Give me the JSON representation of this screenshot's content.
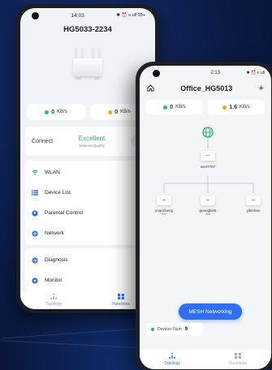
{
  "colors": {
    "accent_blue": "#2f6ff0",
    "status_green": "#2eb872",
    "download_green": "#27c07a",
    "upload_orange": "#f5a623"
  },
  "phone1": {
    "status": {
      "time": "14:03",
      "icons": "✱ ⏰ ≡ ull 35+"
    },
    "title": "HG5033-2234",
    "speeds": [
      {
        "icon": "download-dot",
        "value": "0",
        "unit": "KB/s"
      },
      {
        "icon": "upload-dot",
        "value": "0",
        "unit": "KB/s"
      }
    ],
    "connect": {
      "label": "Connect",
      "quality": "Excellent",
      "quality_label": "Network Quality"
    },
    "menu": [
      {
        "icon": "wifi-icon",
        "label": "WLAN"
      },
      {
        "icon": "list-icon",
        "label": "Device List"
      },
      {
        "icon": "parental-icon",
        "label": "Parental Control"
      },
      {
        "icon": "network-icon",
        "label": "Network"
      }
    ],
    "menu2": [
      {
        "icon": "diagnosis-icon",
        "label": "Diagnosis"
      },
      {
        "icon": "monitor-icon",
        "label": "Monitor"
      }
    ],
    "tabs": [
      {
        "icon": "topology-icon",
        "label": "Topology"
      },
      {
        "icon": "functions-icon",
        "label": "Functions"
      }
    ]
  },
  "phone2": {
    "status": {
      "time": "2:13",
      "icons": "✱ ⏰ ≡ ull"
    },
    "title": "Office_HG5013",
    "speeds": [
      {
        "icon": "download-dot",
        "value": "0",
        "unit": "KB/s"
      },
      {
        "icon": "upload-dot",
        "value": "1.6",
        "unit": "KB/s"
      }
    ],
    "topology": {
      "main_node": "wen7787",
      "children": [
        {
          "name": "yuanzheng",
          "sub": "985"
        },
        {
          "name": "guangbin9",
          "sub": "986"
        },
        {
          "name": "yibinhao",
          "sub": ""
        }
      ]
    },
    "mesh_button": "MESH Networking",
    "devices": {
      "label": "Devices Num",
      "count": "9"
    },
    "tabs": [
      {
        "icon": "topology-icon",
        "label": "Topology"
      },
      {
        "icon": "functions-icon",
        "label": "Functions"
      }
    ]
  }
}
